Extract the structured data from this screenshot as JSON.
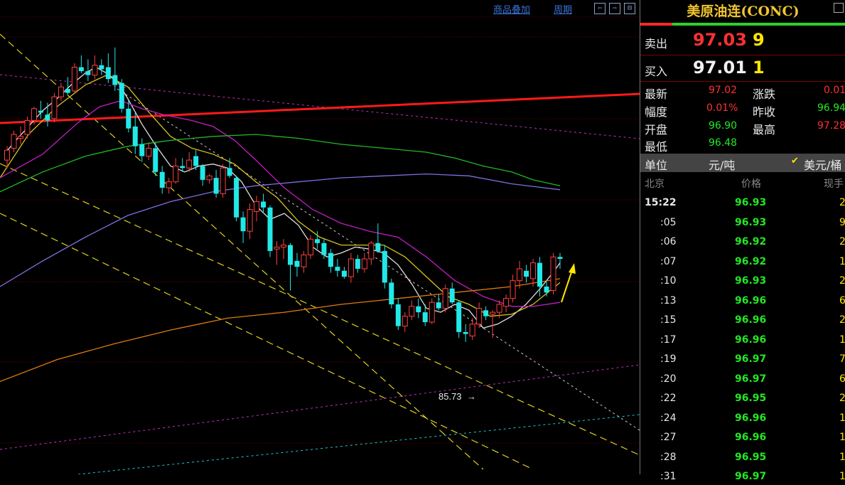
{
  "toolbar": {
    "overlay_label": "商品叠加",
    "period_label": "周期",
    "nav_buttons": [
      "⇦",
      "⇨",
      "⊟"
    ]
  },
  "chart_annotation": {
    "low_label": "85.73"
  },
  "chart_data": {
    "type": "candlestick",
    "candles": [
      {
        "o": 85.9,
        "h": 86.6,
        "l": 85.5,
        "c": 86.4
      },
      {
        "o": 86.5,
        "h": 87.4,
        "l": 86.3,
        "c": 87.2
      },
      {
        "o": 87.0,
        "h": 87.6,
        "l": 86.7,
        "c": 87.1
      },
      {
        "o": 87.2,
        "h": 88.1,
        "l": 87.0,
        "c": 87.9
      },
      {
        "o": 87.9,
        "h": 88.6,
        "l": 87.7,
        "c": 88.5
      },
      {
        "o": 88.4,
        "h": 88.9,
        "l": 88.0,
        "c": 88.3
      },
      {
        "o": 88.2,
        "h": 88.8,
        "l": 87.6,
        "c": 87.9
      },
      {
        "o": 88.0,
        "h": 89.3,
        "l": 87.8,
        "c": 89.1
      },
      {
        "o": 89.1,
        "h": 89.8,
        "l": 88.9,
        "c": 89.6
      },
      {
        "o": 89.5,
        "h": 90.1,
        "l": 89.2,
        "c": 89.3
      },
      {
        "o": 89.4,
        "h": 90.8,
        "l": 89.3,
        "c": 90.6
      },
      {
        "o": 90.6,
        "h": 91.2,
        "l": 90.3,
        "c": 90.4
      },
      {
        "o": 90.4,
        "h": 91.0,
        "l": 89.9,
        "c": 90.2
      },
      {
        "o": 90.2,
        "h": 91.2,
        "l": 90.0,
        "c": 90.7
      },
      {
        "o": 90.7,
        "h": 91.0,
        "l": 90.2,
        "c": 90.5
      },
      {
        "o": 90.6,
        "h": 91.3,
        "l": 89.8,
        "c": 90.0
      },
      {
        "o": 90.2,
        "h": 91.6,
        "l": 89.4,
        "c": 89.7
      },
      {
        "o": 89.8,
        "h": 90.0,
        "l": 88.3,
        "c": 88.5
      },
      {
        "o": 88.5,
        "h": 88.9,
        "l": 87.3,
        "c": 87.5
      },
      {
        "o": 87.6,
        "h": 88.3,
        "l": 86.2,
        "c": 86.6
      },
      {
        "o": 86.7,
        "h": 87.0,
        "l": 85.8,
        "c": 86.1
      },
      {
        "o": 86.1,
        "h": 86.8,
        "l": 85.9,
        "c": 86.5
      },
      {
        "o": 86.5,
        "h": 86.8,
        "l": 85.1,
        "c": 85.3
      },
      {
        "o": 85.3,
        "h": 85.6,
        "l": 84.2,
        "c": 84.5
      },
      {
        "o": 84.5,
        "h": 85.0,
        "l": 84.2,
        "c": 84.8
      },
      {
        "o": 84.8,
        "h": 86.0,
        "l": 84.7,
        "c": 85.6
      },
      {
        "o": 85.6,
        "h": 86.0,
        "l": 85.3,
        "c": 85.5
      },
      {
        "o": 85.5,
        "h": 86.3,
        "l": 85.3,
        "c": 85.9
      },
      {
        "o": 86.1,
        "h": 86.4,
        "l": 85.4,
        "c": 85.6
      },
      {
        "o": 85.6,
        "h": 85.7,
        "l": 84.6,
        "c": 84.9
      },
      {
        "o": 84.9,
        "h": 85.2,
        "l": 84.7,
        "c": 85.1
      },
      {
        "o": 85.0,
        "h": 85.4,
        "l": 84.0,
        "c": 84.2
      },
      {
        "o": 84.2,
        "h": 85.7,
        "l": 84.0,
        "c": 85.5
      },
      {
        "o": 85.5,
        "h": 86.0,
        "l": 85.0,
        "c": 85.1
      },
      {
        "o": 85.0,
        "h": 85.1,
        "l": 82.8,
        "c": 83.0
      },
      {
        "o": 83.0,
        "h": 83.3,
        "l": 81.7,
        "c": 82.3
      },
      {
        "o": 82.3,
        "h": 83.7,
        "l": 81.9,
        "c": 83.4
      },
      {
        "o": 83.3,
        "h": 84.1,
        "l": 82.8,
        "c": 83.8
      },
      {
        "o": 83.8,
        "h": 84.2,
        "l": 83.2,
        "c": 83.5
      },
      {
        "o": 83.5,
        "h": 83.6,
        "l": 81.0,
        "c": 81.3
      },
      {
        "o": 81.4,
        "h": 81.8,
        "l": 80.6,
        "c": 81.5
      },
      {
        "o": 81.5,
        "h": 81.9,
        "l": 80.9,
        "c": 81.6
      },
      {
        "o": 81.6,
        "h": 81.7,
        "l": 79.3,
        "c": 80.6
      },
      {
        "o": 80.8,
        "h": 81.2,
        "l": 80.0,
        "c": 80.5
      },
      {
        "o": 80.5,
        "h": 81.3,
        "l": 80.2,
        "c": 81.1
      },
      {
        "o": 81.1,
        "h": 82.1,
        "l": 80.9,
        "c": 81.9
      },
      {
        "o": 81.9,
        "h": 82.3,
        "l": 81.4,
        "c": 81.7
      },
      {
        "o": 81.7,
        "h": 81.9,
        "l": 80.9,
        "c": 81.1
      },
      {
        "o": 81.2,
        "h": 81.4,
        "l": 80.2,
        "c": 80.5
      },
      {
        "o": 80.5,
        "h": 80.9,
        "l": 80.0,
        "c": 80.3
      },
      {
        "o": 80.3,
        "h": 80.5,
        "l": 79.9,
        "c": 80.0
      },
      {
        "o": 80.0,
        "h": 81.2,
        "l": 79.7,
        "c": 80.9
      },
      {
        "o": 80.9,
        "h": 81.1,
        "l": 80.2,
        "c": 80.4
      },
      {
        "o": 80.4,
        "h": 81.2,
        "l": 80.2,
        "c": 80.9
      },
      {
        "o": 80.9,
        "h": 81.8,
        "l": 80.6,
        "c": 81.7
      },
      {
        "o": 81.7,
        "h": 82.7,
        "l": 81.2,
        "c": 81.3
      },
      {
        "o": 81.3,
        "h": 81.6,
        "l": 79.4,
        "c": 79.7
      },
      {
        "o": 79.7,
        "h": 79.9,
        "l": 78.4,
        "c": 78.6
      },
      {
        "o": 78.6,
        "h": 78.9,
        "l": 77.3,
        "c": 77.5
      },
      {
        "o": 77.5,
        "h": 78.2,
        "l": 77.2,
        "c": 78.0
      },
      {
        "o": 78.0,
        "h": 78.8,
        "l": 77.8,
        "c": 78.5
      },
      {
        "o": 78.5,
        "h": 78.9,
        "l": 77.9,
        "c": 78.2
      },
      {
        "o": 78.2,
        "h": 78.6,
        "l": 77.5,
        "c": 77.7
      },
      {
        "o": 77.7,
        "h": 78.9,
        "l": 77.6,
        "c": 78.7
      },
      {
        "o": 78.7,
        "h": 79.1,
        "l": 78.3,
        "c": 78.4
      },
      {
        "o": 78.4,
        "h": 79.6,
        "l": 78.2,
        "c": 79.4
      },
      {
        "o": 79.4,
        "h": 79.7,
        "l": 78.6,
        "c": 78.7
      },
      {
        "o": 78.7,
        "h": 78.8,
        "l": 76.9,
        "c": 77.2
      },
      {
        "o": 77.2,
        "h": 77.6,
        "l": 76.7,
        "c": 77.1
      },
      {
        "o": 77.0,
        "h": 77.9,
        "l": 76.8,
        "c": 77.6
      },
      {
        "o": 77.6,
        "h": 78.7,
        "l": 77.4,
        "c": 78.4
      },
      {
        "o": 78.3,
        "h": 78.5,
        "l": 77.8,
        "c": 78.0
      },
      {
        "o": 78.1,
        "h": 78.3,
        "l": 76.9,
        "c": 78.2
      },
      {
        "o": 78.2,
        "h": 78.8,
        "l": 77.9,
        "c": 78.6
      },
      {
        "o": 78.5,
        "h": 79.1,
        "l": 78.2,
        "c": 78.9
      },
      {
        "o": 78.9,
        "h": 80.1,
        "l": 78.7,
        "c": 79.8
      },
      {
        "o": 79.8,
        "h": 80.8,
        "l": 79.4,
        "c": 80.4
      },
      {
        "o": 80.3,
        "h": 80.6,
        "l": 79.7,
        "c": 80.0
      },
      {
        "o": 79.9,
        "h": 80.9,
        "l": 79.5,
        "c": 80.7
      },
      {
        "o": 80.7,
        "h": 81.0,
        "l": 79.0,
        "c": 79.5
      },
      {
        "o": 79.5,
        "h": 79.8,
        "l": 79.0,
        "c": 79.2
      },
      {
        "o": 79.3,
        "h": 81.2,
        "l": 79.1,
        "c": 81.0
      },
      {
        "o": 81.0,
        "h": 81.2,
        "l": 80.4,
        "c": 80.9
      }
    ],
    "ylim": [
      70,
      94
    ],
    "lines": [
      {
        "name": "ma5",
        "color": "#e0e0e0",
        "pts": [
          [
            6,
            86.2
          ],
          [
            20,
            86.8
          ],
          [
            40,
            87.6
          ],
          [
            60,
            88.4
          ],
          [
            80,
            89.0
          ],
          [
            100,
            89.7
          ],
          [
            120,
            90.3
          ],
          [
            135,
            90.6
          ],
          [
            150,
            90.3
          ],
          [
            165,
            89.9
          ],
          [
            180,
            89.0
          ],
          [
            200,
            87.7
          ],
          [
            220,
            86.6
          ],
          [
            240,
            85.6
          ],
          [
            260,
            85.3
          ],
          [
            280,
            85.6
          ],
          [
            300,
            85.7
          ],
          [
            320,
            85.5
          ],
          [
            340,
            84.8
          ],
          [
            360,
            83.6
          ],
          [
            380,
            82.9
          ],
          [
            400,
            83.2
          ],
          [
            420,
            82.6
          ],
          [
            440,
            81.5
          ],
          [
            460,
            81.0
          ],
          [
            480,
            81.2
          ],
          [
            500,
            81.5
          ],
          [
            520,
            81.4
          ],
          [
            540,
            81.2
          ],
          [
            560,
            80.6
          ],
          [
            580,
            79.6
          ],
          [
            600,
            78.4
          ],
          [
            620,
            78.2
          ],
          [
            640,
            78.6
          ],
          [
            660,
            78.3
          ],
          [
            680,
            77.4
          ],
          [
            700,
            77.6
          ],
          [
            720,
            78.0
          ],
          [
            740,
            78.6
          ],
          [
            760,
            79.4
          ],
          [
            780,
            80.3
          ],
          [
            788,
            80.7
          ]
        ]
      },
      {
        "name": "ma10",
        "color": "#d6c21c",
        "pts": [
          [
            0,
            85.0
          ],
          [
            40,
            87.2
          ],
          [
            80,
            88.6
          ],
          [
            120,
            89.7
          ],
          [
            150,
            90.2
          ],
          [
            180,
            89.6
          ],
          [
            210,
            88.3
          ],
          [
            240,
            87.1
          ],
          [
            270,
            86.5
          ],
          [
            300,
            86.2
          ],
          [
            330,
            85.7
          ],
          [
            360,
            84.8
          ],
          [
            390,
            84.0
          ],
          [
            420,
            82.8
          ],
          [
            450,
            82.0
          ],
          [
            480,
            81.6
          ],
          [
            510,
            81.6
          ],
          [
            540,
            81.6
          ],
          [
            570,
            81.0
          ],
          [
            600,
            80.0
          ],
          [
            630,
            79.0
          ],
          [
            660,
            78.6
          ],
          [
            690,
            78.0
          ],
          [
            720,
            78.1
          ],
          [
            750,
            78.6
          ],
          [
            788,
            79.7
          ]
        ]
      },
      {
        "name": "ma20",
        "color": "#c21ec2",
        "pts": [
          [
            0,
            85.0
          ],
          [
            60,
            86.2
          ],
          [
            110,
            87.8
          ],
          [
            140,
            88.6
          ],
          [
            170,
            88.9
          ],
          [
            200,
            88.5
          ],
          [
            230,
            88.2
          ],
          [
            270,
            87.9
          ],
          [
            300,
            87.6
          ],
          [
            330,
            86.9
          ],
          [
            360,
            85.9
          ],
          [
            400,
            84.5
          ],
          [
            440,
            83.4
          ],
          [
            480,
            82.7
          ],
          [
            520,
            82.3
          ],
          [
            560,
            82.0
          ],
          [
            600,
            81.0
          ],
          [
            640,
            79.8
          ],
          [
            680,
            79.0
          ],
          [
            720,
            78.5
          ],
          [
            750,
            78.5
          ],
          [
            788,
            78.7
          ]
        ]
      },
      {
        "name": "ma60",
        "color": "#22b822",
        "pts": [
          [
            0,
            84.3
          ],
          [
            60,
            85.3
          ],
          [
            120,
            86.1
          ],
          [
            180,
            86.6
          ],
          [
            240,
            86.9
          ],
          [
            300,
            87.1
          ],
          [
            360,
            87.2
          ],
          [
            420,
            87.0
          ],
          [
            480,
            86.7
          ],
          [
            540,
            86.5
          ],
          [
            600,
            86.3
          ],
          [
            640,
            86.0
          ],
          [
            680,
            85.6
          ],
          [
            720,
            85.3
          ],
          [
            750,
            84.9
          ],
          [
            788,
            84.6
          ]
        ]
      },
      {
        "name": "ma120",
        "color": "#7f6fe0",
        "pts": [
          [
            0,
            79.5
          ],
          [
            60,
            80.8
          ],
          [
            120,
            82.0
          ],
          [
            180,
            83.1
          ],
          [
            240,
            83.8
          ],
          [
            300,
            84.3
          ],
          [
            360,
            84.6
          ],
          [
            420,
            84.8
          ],
          [
            480,
            85.0
          ],
          [
            540,
            85.1
          ],
          [
            600,
            85.2
          ],
          [
            660,
            85.1
          ],
          [
            720,
            84.7
          ],
          [
            788,
            84.4
          ]
        ]
      },
      {
        "name": "ma250",
        "color": "#e07a10",
        "pts": [
          [
            0,
            74.7
          ],
          [
            80,
            75.8
          ],
          [
            160,
            76.6
          ],
          [
            240,
            77.3
          ],
          [
            320,
            77.9
          ],
          [
            400,
            78.2
          ],
          [
            480,
            78.6
          ],
          [
            560,
            78.9
          ],
          [
            640,
            79.2
          ],
          [
            720,
            79.5
          ],
          [
            788,
            79.9
          ]
        ]
      }
    ]
  },
  "panel": {
    "title": "美原油连(CONC)",
    "sell_label": "卖出",
    "sell_price": "97.03",
    "sell_qty": "9",
    "buy_label": "买入",
    "buy_price": "97.01",
    "buy_qty": "1",
    "stats": {
      "latest_label": "最新",
      "latest": "97.02",
      "change_label": "涨跌",
      "change": "0.01",
      "range_label": "幅度",
      "range": "0.01%",
      "prev_close_label": "昨收",
      "prev_close": "96.94",
      "open_label": "开盘",
      "open": "96.90",
      "high_label": "最高",
      "high": "97.28",
      "low_label": "最低",
      "low": "96.48"
    },
    "unit_label": "单位",
    "unit_cny": "元/吨",
    "unit_usd": "美元/桶",
    "ticks_header": {
      "time": "北京",
      "price": "价格",
      "qty": "现手"
    },
    "ticks": [
      {
        "time": "15:22",
        "price": "96.93",
        "qty": "2"
      },
      {
        "time": ":05",
        "price": "96.93",
        "qty": "9"
      },
      {
        "time": ":06",
        "price": "96.92",
        "qty": "2"
      },
      {
        "time": ":07",
        "price": "96.92",
        "qty": "1"
      },
      {
        "time": ":10",
        "price": "96.93",
        "qty": "2"
      },
      {
        "time": ":13",
        "price": "96.96",
        "qty": "6"
      },
      {
        "time": ":15",
        "price": "96.96",
        "qty": "2"
      },
      {
        "time": ":17",
        "price": "96.96",
        "qty": "1"
      },
      {
        "time": ":19",
        "price": "96.97",
        "qty": "7"
      },
      {
        "time": ":20",
        "price": "96.97",
        "qty": "6"
      },
      {
        "time": ":22",
        "price": "96.95",
        "qty": "2"
      },
      {
        "time": ":24",
        "price": "96.96",
        "qty": "1"
      },
      {
        "time": ":27",
        "price": "96.96",
        "qty": "1"
      },
      {
        "time": ":28",
        "price": "96.95",
        "qty": "1"
      },
      {
        "time": ":31",
        "price": "96.97",
        "qty": "1"
      }
    ],
    "colors": {
      "up": "#ff3030",
      "down": "#22e822",
      "neutral": "#e8e8e8",
      "yellow": "#ffe600"
    }
  }
}
